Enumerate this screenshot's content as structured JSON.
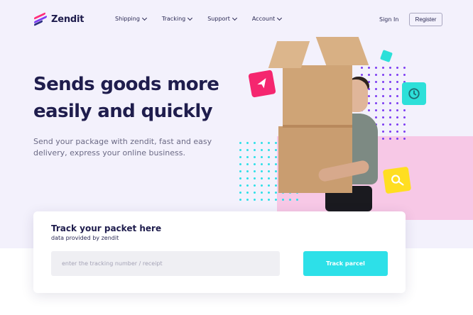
{
  "brand": {
    "name": "Zendit"
  },
  "nav": {
    "items": [
      {
        "label": "Shipping"
      },
      {
        "label": "Tracking"
      },
      {
        "label": "Support"
      },
      {
        "label": "Account"
      }
    ],
    "signin_label": "Sign In",
    "register_label": "Register"
  },
  "hero": {
    "headline": "Sends goods more easily and quickly",
    "subtext": "Send your package with zendit, fast and easy delivery, express your online business."
  },
  "tracking": {
    "title": "Track your packet here",
    "subtitle": "data provided by zendit",
    "input_placeholder": "enter the tracking number / receipt",
    "input_value": "",
    "button_label": "Track parcel"
  },
  "decor": {
    "icons": [
      "send-icon",
      "clock-icon",
      "search-icon"
    ],
    "colors": {
      "accent_cyan": "#2de0e8",
      "accent_pink": "#f5266f",
      "accent_yellow": "#ffde21",
      "accent_purple": "#7d3cf2",
      "pink_block": "#f7c8e6",
      "hero_bg": "#f3f1fc",
      "text_dark": "#1f1d4d"
    }
  }
}
